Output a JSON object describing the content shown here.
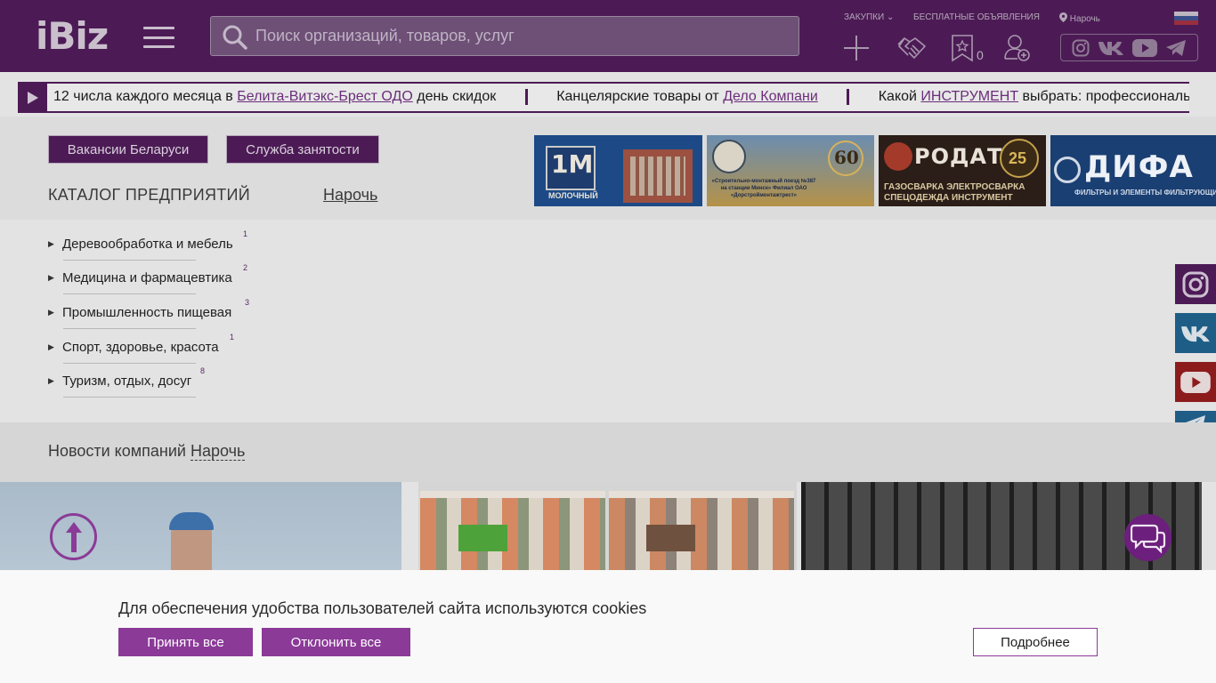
{
  "header": {
    "logo": "iBiz",
    "search_placeholder": "Поиск организаций, товаров, услуг",
    "links": {
      "purchases": "ЗАКУПКИ",
      "free_ads": "БЕСПЛАТНЫЕ ОБЪЯВЛЕНИЯ",
      "location": "Нарочь"
    },
    "favorites_count": "0",
    "icons": [
      "plus-icon",
      "handshake-icon",
      "favorites-icon",
      "add-user-icon",
      "instagram-icon",
      "vk-icon",
      "youtube-icon",
      "telegram-icon"
    ]
  },
  "ticker": {
    "items": [
      {
        "before": "12 числа каждого месяца в ",
        "link": "Белита-Витэкс-Брест ОДО",
        "after": " день скидок"
      },
      {
        "before": "Канцелярские товары от ",
        "link": "Дело Компани",
        "after": ""
      },
      {
        "before": "Какой ",
        "link": "ИНСТРУМЕНТ",
        "after": " выбрать: профессиональный ил"
      }
    ]
  },
  "top": {
    "btn_vacancies": "Вакансии Беларуси",
    "btn_employment": "Служба занятости",
    "catalog_title": "КАТАЛОГ ПРЕДПРИЯТИЙ",
    "city": "Нарочь"
  },
  "banners": {
    "b1": {
      "big": "1М",
      "small": "МОЛОЧНЫЙ"
    },
    "b2": {
      "text": "«Строительно-монтажный поезд №387 на станции Минск» Филиал ОАО «Дорстроймонтажтрест»",
      "years": "60"
    },
    "b3": {
      "brand": "РОДАТ",
      "line1": "ГАЗОСВАРКА ЭЛЕКТРОСВАРКА",
      "line2": "СПЕЦОДЕЖДА ИНСТРУМЕНТ",
      "years": "25"
    },
    "b4": {
      "brand": "ДИФА",
      "line": "ФИЛЬТРЫ И ЭЛЕМЕНТЫ ФИЛЬТРУЮЩИЕ"
    }
  },
  "catalog": [
    {
      "label": "Деревообработка и мебель",
      "count": "1"
    },
    {
      "label": "Медицина и фармацевтика",
      "count": "2"
    },
    {
      "label": "Промышленность пищевая",
      "count": "3"
    },
    {
      "label": "Спорт, здоровье, красота",
      "count": "1"
    },
    {
      "label": "Туризм, отдых, досуг",
      "count": "8"
    }
  ],
  "news": {
    "title": "Новости компаний",
    "city": "Нарочь"
  },
  "cookie": {
    "text": "Для обеспечения удобства пользователей сайта используются cookies",
    "accept": "Принять все",
    "decline": "Отклонить все",
    "more": "Подробнее"
  },
  "colors": {
    "brand": "#4c1b55",
    "accent": "#8b3a98"
  }
}
